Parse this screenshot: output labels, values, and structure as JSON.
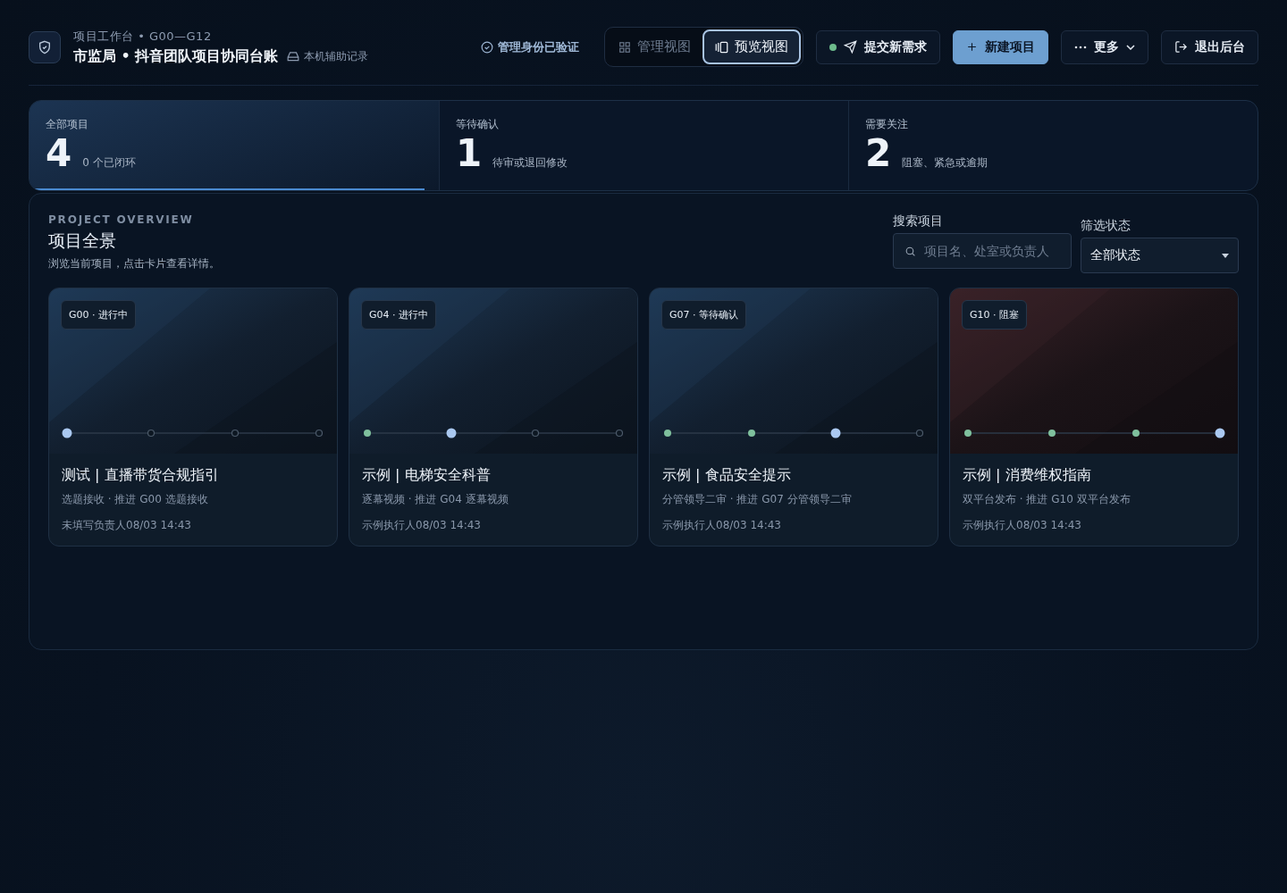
{
  "header": {
    "eyebrow": "项目工作台 • G00—G12",
    "title": "市监局 • 抖音团队项目协同台账",
    "storage": "本机辅助记录",
    "verified": "管理身份已验证"
  },
  "view_tabs": [
    {
      "label": "管理视图",
      "selected": false
    },
    {
      "label": "预览视图",
      "selected": true
    }
  ],
  "actions": [
    {
      "kind": "submit",
      "label": "提交新需求"
    },
    {
      "kind": "primary",
      "label": "新建项目"
    },
    {
      "kind": "more",
      "label": "更多"
    },
    {
      "kind": "logout",
      "label": "退出后台"
    }
  ],
  "stats": [
    {
      "label": "全部项目",
      "value": "4",
      "note": "0 个已闭环",
      "selected": true
    },
    {
      "label": "等待确认",
      "value": "1",
      "note": "待审或退回修改",
      "selected": false
    },
    {
      "label": "需要关注",
      "value": "2",
      "note": "阻塞、紧急或逾期",
      "selected": false
    }
  ],
  "overview": {
    "eyebrow": "PROJECT OVERVIEW",
    "title": "项目全景",
    "subtitle": "浏览当前项目，点击卡片查看详情。",
    "search_label": "搜索项目",
    "search_placeholder": "项目名、处室或负责人",
    "filter_label": "筛选状态",
    "filter_value": "全部状态"
  },
  "cards": [
    {
      "badge": "G00 · 进行中",
      "blocked": false,
      "steps": [
        {
          "kind": "current"
        },
        {
          "kind": "todo"
        },
        {
          "kind": "todo"
        },
        {
          "kind": "todo"
        }
      ],
      "title": "测试 | 直播带货合规指引",
      "stage": "选题接收 · 推进 G00 选题接收",
      "meta": "未填写负责人08/03 14:43"
    },
    {
      "badge": "G04 · 进行中",
      "blocked": false,
      "steps": [
        {
          "kind": "done"
        },
        {
          "kind": "current"
        },
        {
          "kind": "todo"
        },
        {
          "kind": "todo"
        }
      ],
      "title": "示例 | 电梯安全科普",
      "stage": "逐幕视频 · 推进 G04 逐幕视频",
      "meta": "示例执行人08/03 14:43"
    },
    {
      "badge": "G07 · 等待确认",
      "blocked": false,
      "steps": [
        {
          "kind": "done"
        },
        {
          "kind": "done"
        },
        {
          "kind": "current"
        },
        {
          "kind": "todo"
        }
      ],
      "title": "示例 | 食品安全提示",
      "stage": "分管领导二审 · 推进 G07 分管领导二审",
      "meta": "示例执行人08/03 14:43"
    },
    {
      "badge": "G10 · 阻塞",
      "blocked": true,
      "steps": [
        {
          "kind": "done"
        },
        {
          "kind": "done"
        },
        {
          "kind": "done"
        },
        {
          "kind": "current"
        }
      ],
      "title": "示例 | 消费维权指南",
      "stage": "双平台发布 · 推进 G10 双平台发布",
      "meta": "示例执行人08/03 14:43"
    }
  ]
}
